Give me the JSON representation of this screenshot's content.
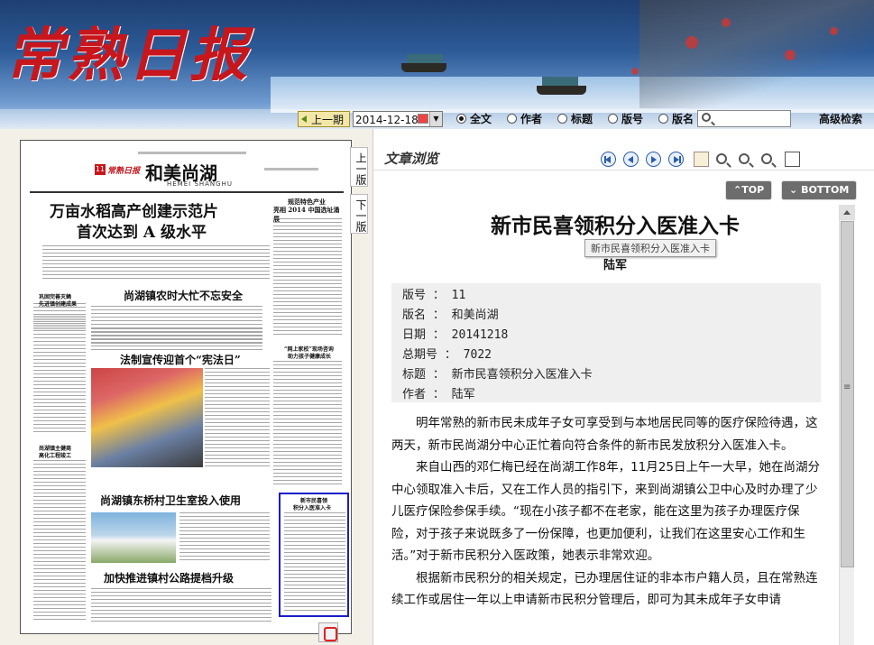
{
  "header": {
    "logo_text": "常熟日报"
  },
  "toolbar": {
    "prev_issue_label": "上一期",
    "date_value": "2014-12-18",
    "search_options": [
      "全文",
      "作者",
      "标题",
      "版号",
      "版名"
    ],
    "selected_option": "全文",
    "advanced_search_label": "高级检索"
  },
  "newspaper": {
    "page_number": "11",
    "brand": "常熟日报",
    "section_name": "和美尚湖",
    "section_pinyin": "HEMEI SHANGHU",
    "headline_main_1": "万亩水稻高产创建示范片",
    "headline_main_2": "首次达到 A 级水平",
    "side_headline_1": "规范特色产业",
    "side_headline_2": "亮相 2014 中国选址涌展",
    "headline_2": "尚湖镇农时大忙不忘安全",
    "box_title_1": "巩固完善灭蝇",
    "box_title_2": "先进镇创建成果",
    "headline_3": "法制宣传迎首个“宪法日”",
    "side_headline_3": "“网上家校”现场咨询",
    "side_headline_4": "助力孩子健康成长",
    "box_title_3": "尚湖镇主健商",
    "box_title_4": "高化工程竣工",
    "headline_4": "尚湖镇东桥村卫生室投入使用",
    "headline_5": "加快推进镇村公路提档升级",
    "selected_article_1": "新市民喜领",
    "selected_article_2": "积分入医准入卡",
    "page_tab_prev": "上一版",
    "page_tab_next": "下一版"
  },
  "viewer": {
    "title": "文章浏览",
    "top_button": "TOP",
    "bottom_button": "BOTTOM"
  },
  "article": {
    "title": "新市民喜领积分入医准入卡",
    "tooltip": "新市民喜领积分入医准入卡",
    "author_line": "陆军",
    "meta": [
      {
        "label": "版号",
        "value": "11"
      },
      {
        "label": "版名",
        "value": "和美尚湖"
      },
      {
        "label": "日期",
        "value": "20141218"
      },
      {
        "label": "总期号",
        "value": "7022"
      },
      {
        "label": "标题",
        "value": "新市民喜领积分入医准入卡"
      },
      {
        "label": "作者",
        "value": "陆军"
      }
    ],
    "paragraphs": [
      "明年常熟的新市民未成年子女可享受到与本地居民同等的医疗保险待遇，这两天，新市民尚湖分中心正忙着向符合条件的新市民发放积分入医准入卡。",
      "来自山西的邓仁梅已经在尚湖工作8年，11月25日上午一大早，她在尚湖分中心领取准入卡后，又在工作人员的指引下，来到尚湖镇公卫中心及时办理了少儿医疗保险参保手续。“现在小孩子都不在老家，能在这里为孩子办理医疗保险，对于孩子来说既多了一份保障，也更加便利，让我们在这里安心工作和生活。”对于新市民积分入医政策，她表示非常欢迎。",
      "根据新市民积分的相关规定，已办理居住证的非本市户籍人员，且在常熟连续工作或居住一年以上申请新市民积分管理后，即可为其未成年子女申请"
    ]
  },
  "colors": {
    "logo_red": "#c7161c",
    "selection_blue": "#1c1cc9",
    "meta_bg": "#efefef"
  },
  "icons": [
    "first-page-icon",
    "prev-icon",
    "next-icon",
    "last-page-icon",
    "document-icon",
    "zoom-in-icon",
    "zoom-reset-icon",
    "zoom-out-icon",
    "copy-icon",
    "pdf-icon",
    "search-icon",
    "calendar-icon"
  ]
}
